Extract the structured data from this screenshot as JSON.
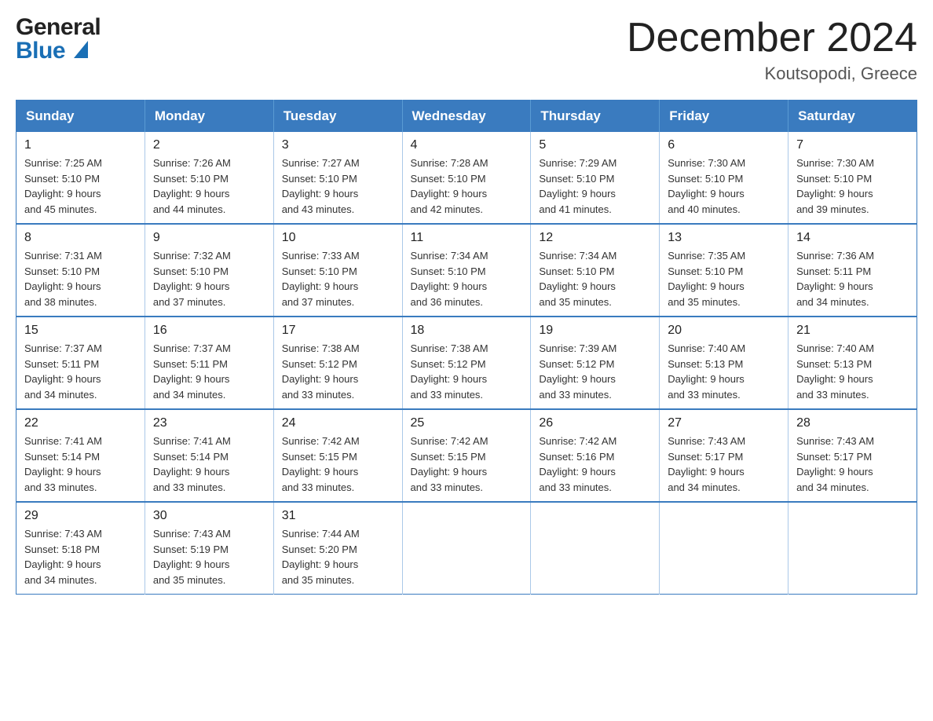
{
  "logo": {
    "general_text": "General",
    "blue_text": "Blue"
  },
  "header": {
    "month_year": "December 2024",
    "location": "Koutsopodi, Greece"
  },
  "days_of_week": [
    "Sunday",
    "Monday",
    "Tuesday",
    "Wednesday",
    "Thursday",
    "Friday",
    "Saturday"
  ],
  "weeks": [
    [
      {
        "day": "1",
        "sunrise": "7:25 AM",
        "sunset": "5:10 PM",
        "daylight": "9 hours and 45 minutes."
      },
      {
        "day": "2",
        "sunrise": "7:26 AM",
        "sunset": "5:10 PM",
        "daylight": "9 hours and 44 minutes."
      },
      {
        "day": "3",
        "sunrise": "7:27 AM",
        "sunset": "5:10 PM",
        "daylight": "9 hours and 43 minutes."
      },
      {
        "day": "4",
        "sunrise": "7:28 AM",
        "sunset": "5:10 PM",
        "daylight": "9 hours and 42 minutes."
      },
      {
        "day": "5",
        "sunrise": "7:29 AM",
        "sunset": "5:10 PM",
        "daylight": "9 hours and 41 minutes."
      },
      {
        "day": "6",
        "sunrise": "7:30 AM",
        "sunset": "5:10 PM",
        "daylight": "9 hours and 40 minutes."
      },
      {
        "day": "7",
        "sunrise": "7:30 AM",
        "sunset": "5:10 PM",
        "daylight": "9 hours and 39 minutes."
      }
    ],
    [
      {
        "day": "8",
        "sunrise": "7:31 AM",
        "sunset": "5:10 PM",
        "daylight": "9 hours and 38 minutes."
      },
      {
        "day": "9",
        "sunrise": "7:32 AM",
        "sunset": "5:10 PM",
        "daylight": "9 hours and 37 minutes."
      },
      {
        "day": "10",
        "sunrise": "7:33 AM",
        "sunset": "5:10 PM",
        "daylight": "9 hours and 37 minutes."
      },
      {
        "day": "11",
        "sunrise": "7:34 AM",
        "sunset": "5:10 PM",
        "daylight": "9 hours and 36 minutes."
      },
      {
        "day": "12",
        "sunrise": "7:34 AM",
        "sunset": "5:10 PM",
        "daylight": "9 hours and 35 minutes."
      },
      {
        "day": "13",
        "sunrise": "7:35 AM",
        "sunset": "5:10 PM",
        "daylight": "9 hours and 35 minutes."
      },
      {
        "day": "14",
        "sunrise": "7:36 AM",
        "sunset": "5:11 PM",
        "daylight": "9 hours and 34 minutes."
      }
    ],
    [
      {
        "day": "15",
        "sunrise": "7:37 AM",
        "sunset": "5:11 PM",
        "daylight": "9 hours and 34 minutes."
      },
      {
        "day": "16",
        "sunrise": "7:37 AM",
        "sunset": "5:11 PM",
        "daylight": "9 hours and 34 minutes."
      },
      {
        "day": "17",
        "sunrise": "7:38 AM",
        "sunset": "5:12 PM",
        "daylight": "9 hours and 33 minutes."
      },
      {
        "day": "18",
        "sunrise": "7:38 AM",
        "sunset": "5:12 PM",
        "daylight": "9 hours and 33 minutes."
      },
      {
        "day": "19",
        "sunrise": "7:39 AM",
        "sunset": "5:12 PM",
        "daylight": "9 hours and 33 minutes."
      },
      {
        "day": "20",
        "sunrise": "7:40 AM",
        "sunset": "5:13 PM",
        "daylight": "9 hours and 33 minutes."
      },
      {
        "day": "21",
        "sunrise": "7:40 AM",
        "sunset": "5:13 PM",
        "daylight": "9 hours and 33 minutes."
      }
    ],
    [
      {
        "day": "22",
        "sunrise": "7:41 AM",
        "sunset": "5:14 PM",
        "daylight": "9 hours and 33 minutes."
      },
      {
        "day": "23",
        "sunrise": "7:41 AM",
        "sunset": "5:14 PM",
        "daylight": "9 hours and 33 minutes."
      },
      {
        "day": "24",
        "sunrise": "7:42 AM",
        "sunset": "5:15 PM",
        "daylight": "9 hours and 33 minutes."
      },
      {
        "day": "25",
        "sunrise": "7:42 AM",
        "sunset": "5:15 PM",
        "daylight": "9 hours and 33 minutes."
      },
      {
        "day": "26",
        "sunrise": "7:42 AM",
        "sunset": "5:16 PM",
        "daylight": "9 hours and 33 minutes."
      },
      {
        "day": "27",
        "sunrise": "7:43 AM",
        "sunset": "5:17 PM",
        "daylight": "9 hours and 34 minutes."
      },
      {
        "day": "28",
        "sunrise": "7:43 AM",
        "sunset": "5:17 PM",
        "daylight": "9 hours and 34 minutes."
      }
    ],
    [
      {
        "day": "29",
        "sunrise": "7:43 AM",
        "sunset": "5:18 PM",
        "daylight": "9 hours and 34 minutes."
      },
      {
        "day": "30",
        "sunrise": "7:43 AM",
        "sunset": "5:19 PM",
        "daylight": "9 hours and 35 minutes."
      },
      {
        "day": "31",
        "sunrise": "7:44 AM",
        "sunset": "5:20 PM",
        "daylight": "9 hours and 35 minutes."
      },
      null,
      null,
      null,
      null
    ]
  ],
  "labels": {
    "sunrise": "Sunrise:",
    "sunset": "Sunset:",
    "daylight": "Daylight:"
  }
}
